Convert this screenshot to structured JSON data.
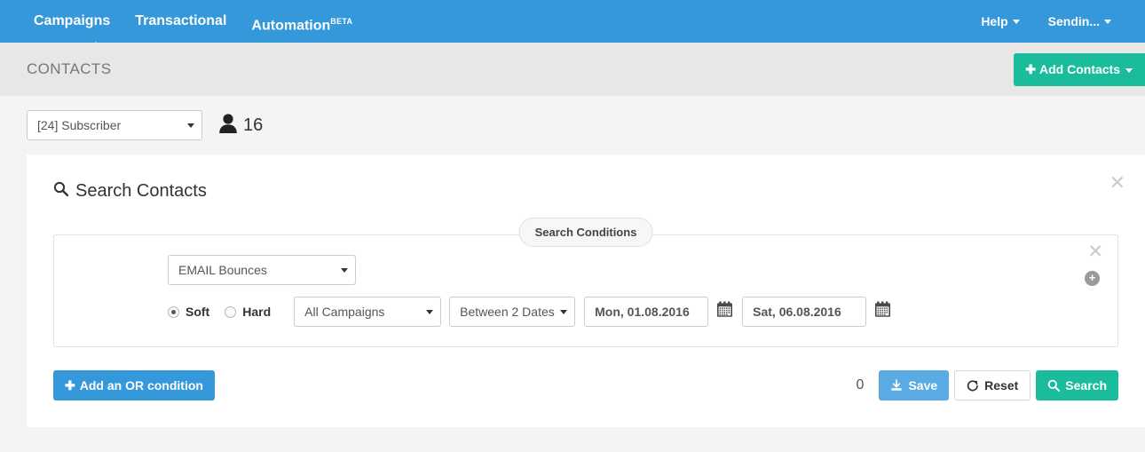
{
  "navbar": {
    "items": [
      {
        "label": "Campaigns",
        "active": true
      },
      {
        "label": "Transactional",
        "active": false
      },
      {
        "label": "Automation",
        "badge": "BETA",
        "active": false
      }
    ],
    "right_items": [
      {
        "label": "Help"
      },
      {
        "label": "Sendin..."
      }
    ]
  },
  "page_header": {
    "title": "CONTACTS",
    "add_contacts_label": "Add Contacts",
    "add_contacts_plus": "✚"
  },
  "subscriber_row": {
    "select_value": "[24] Subscriber",
    "contact_count": "16"
  },
  "search_panel": {
    "title": "Search Contacts",
    "close_label": "✕",
    "legend": "Search Conditions",
    "condition": {
      "close_label": "✕",
      "add_label": "+",
      "type_value": "EMAIL Bounces",
      "radios": [
        {
          "label": "Soft",
          "selected": true
        },
        {
          "label": "Hard",
          "selected": false
        }
      ],
      "campaign_value": "All Campaigns",
      "daterange_value": "Between 2 Dates",
      "date_from": "Mon, 01.08.2016",
      "date_to": "Sat, 06.08.2016"
    }
  },
  "actions": {
    "add_or_label": "Add an OR condition",
    "add_or_plus": "✚",
    "result_count": "0",
    "save_label": "Save",
    "reset_label": "Reset",
    "search_label": "Search"
  },
  "colors": {
    "navbar_blue": "#3498db",
    "green": "#1abc9c",
    "save_blue": "#5aaae4",
    "page_bg": "#f4f4f4",
    "header_band": "#e7e7e7"
  }
}
